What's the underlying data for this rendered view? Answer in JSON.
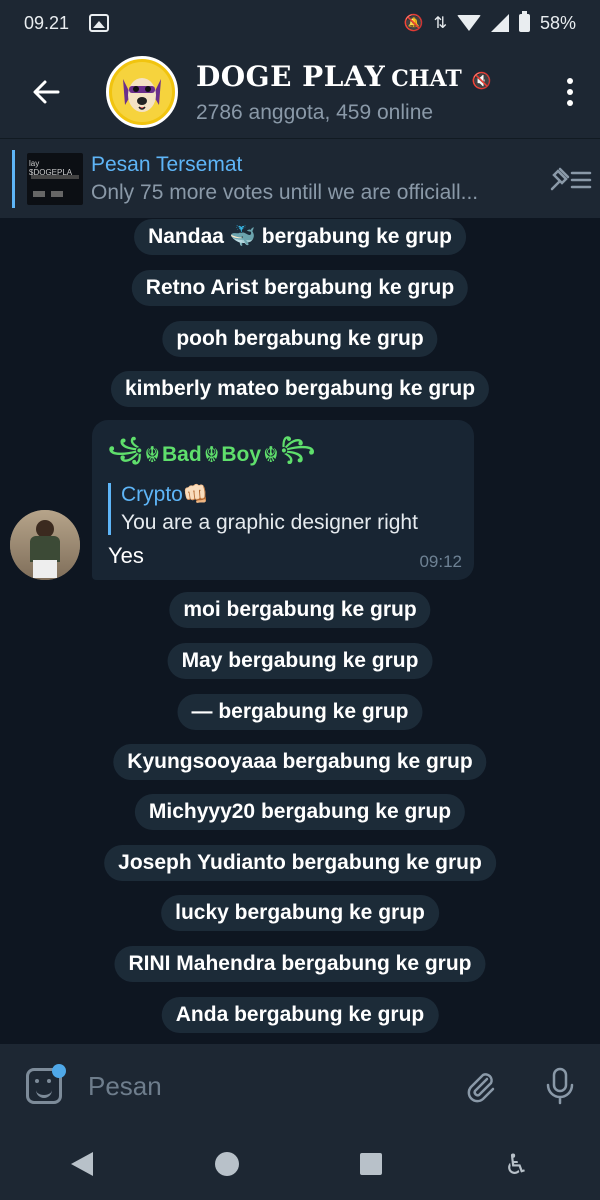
{
  "status_bar": {
    "time": "09.21",
    "battery": "58%"
  },
  "header": {
    "title_main": "DOGE PLAY",
    "title_sub": "CHAT",
    "members": "2786 anggota, 459 online"
  },
  "pinned": {
    "title": "Pesan Tersemat",
    "text": "Only 75 more votes untill we are officiall...",
    "thumb_text": "lay $DOGEPLA"
  },
  "service_messages_top": [
    "Nandaa 🐳 bergabung ke grup",
    "Retno Arist bergabung ke grup",
    "pooh bergabung ke grup",
    "kimberly mateo bergabung ke grup"
  ],
  "message": {
    "sender_name": "Bad",
    "sender_mid": "Boy",
    "reply_name": "Crypto👊🏻",
    "reply_text": "You are a graphic designer right",
    "text": "Yes",
    "time": "09:12"
  },
  "service_messages_bottom": [
    "moi bergabung ke grup",
    "May bergabung ke grup",
    "— bergabung ke grup",
    "Kyungsooyaaa bergabung ke grup",
    "Michyyy20 bergabung ke grup",
    "Joseph Yudianto bergabung ke grup",
    "lucky bergabung ke grup",
    "RINI Mahendra bergabung ke grup",
    "Anda bergabung ke grup"
  ],
  "input": {
    "placeholder": "Pesan"
  }
}
